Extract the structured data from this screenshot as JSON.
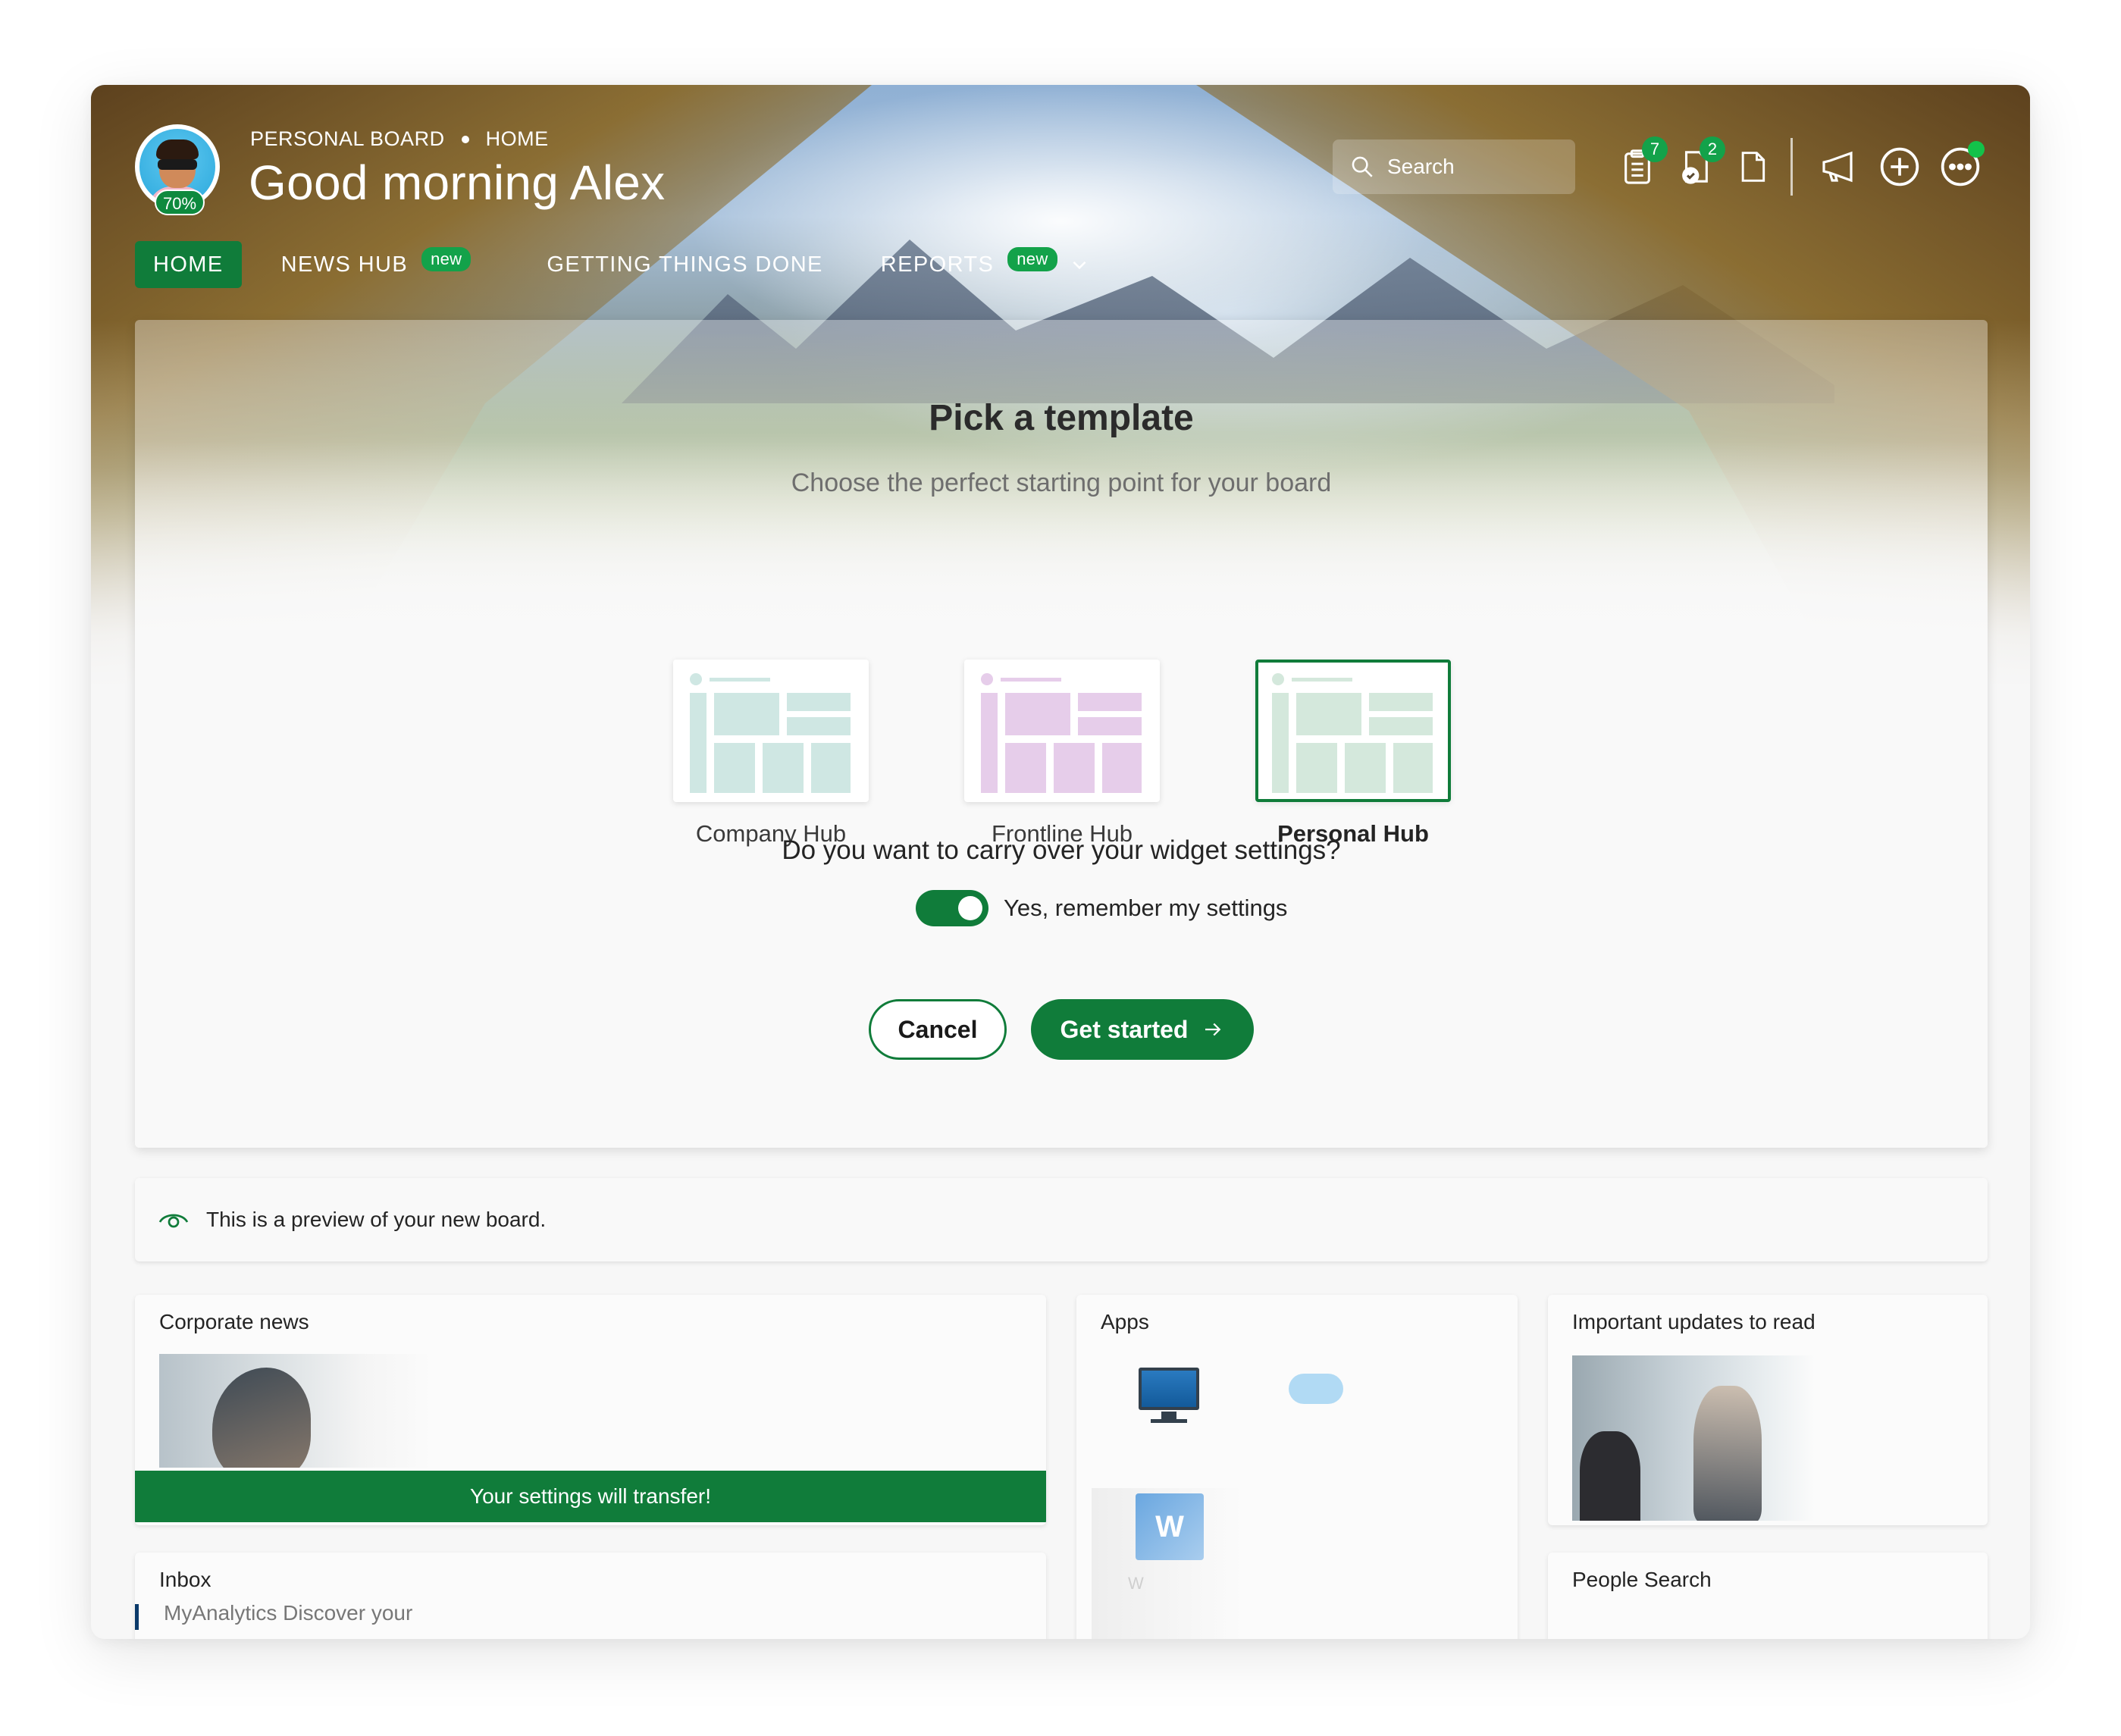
{
  "header": {
    "breadcrumb": [
      "PERSONAL BOARD",
      "HOME"
    ],
    "greeting": "Good morning Alex",
    "profile_completion": "70%",
    "search_placeholder": "Search",
    "icons": [
      {
        "name": "tasks-icon",
        "badge": "7"
      },
      {
        "name": "approvals-icon",
        "badge": "2"
      },
      {
        "name": "document-icon"
      },
      {
        "name": "megaphone-icon"
      },
      {
        "name": "add-icon"
      },
      {
        "name": "more-icon"
      }
    ]
  },
  "nav": {
    "tabs": [
      {
        "label": "HOME",
        "active": true
      },
      {
        "label": "NEWS HUB",
        "badge": "new"
      },
      {
        "label": "GETTING THINGS DONE"
      },
      {
        "label": "REPORTS",
        "badge": "new"
      }
    ]
  },
  "modal": {
    "title": "Pick a template",
    "subtitle": "Choose the perfect starting point for your board",
    "templates": [
      {
        "label": "Company Hub",
        "color": "#cfe7e3",
        "selected": false
      },
      {
        "label": "Frontline Hub",
        "color": "#e6cdea",
        "selected": false
      },
      {
        "label": "Personal Hub",
        "color": "#d4e8dc",
        "selected": true
      }
    ],
    "question": "Do you want to carry over your widget settings?",
    "toggle_label": "Yes, remember my settings",
    "toggle_on": true,
    "cancel_label": "Cancel",
    "start_label": "Get started"
  },
  "notice": {
    "text": "This is a preview of your new board."
  },
  "widgets": {
    "corporate_news": {
      "title": "Corporate news",
      "transfer_text": "Your settings will transfer!"
    },
    "apps": {
      "title": "Apps",
      "tile_letter": "W",
      "tile_label": "W"
    },
    "updates": {
      "title": "Important updates to read"
    },
    "inbox": {
      "title": "Inbox",
      "preview": "MyAnalytics Discover your"
    },
    "people_search": {
      "title": "People Search"
    }
  },
  "colors": {
    "brand_green": "#107c3a",
    "badge_green": "#13a24a"
  }
}
